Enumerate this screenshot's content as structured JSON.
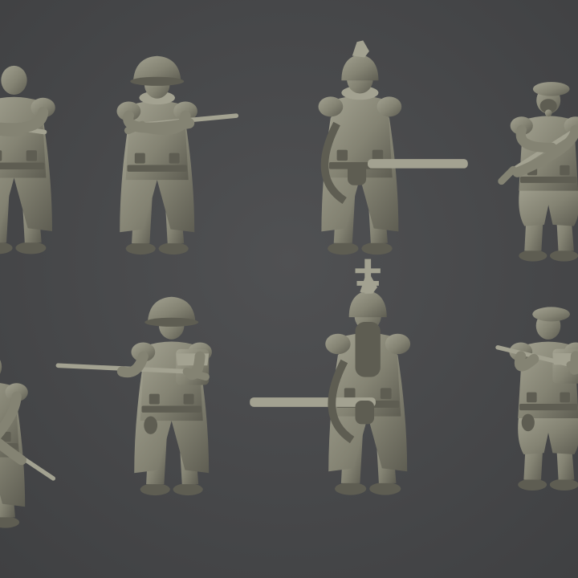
{
  "scene": {
    "background_color": "#4a4b4d",
    "model_color": "#848373",
    "model_shadow_color": "#5e5d52",
    "model_highlight_color": "#a3a291",
    "rows": [
      {
        "name": "front-views",
        "figures": [
          {
            "name": "figure-trenchcoat-partial"
          },
          {
            "name": "figure-morion-helmet-rifle"
          },
          {
            "name": "figure-crested-helmet-flamer"
          },
          {
            "name": "figure-gasmask-beret-rifle"
          }
        ]
      },
      {
        "name": "back-views",
        "figures": [
          {
            "name": "figure-bayonet-partial"
          },
          {
            "name": "figure-morion-backpack-rifle"
          },
          {
            "name": "figure-flamer-fuel-tank-cross"
          },
          {
            "name": "figure-beret-backpack-kneeling"
          }
        ]
      }
    ]
  }
}
